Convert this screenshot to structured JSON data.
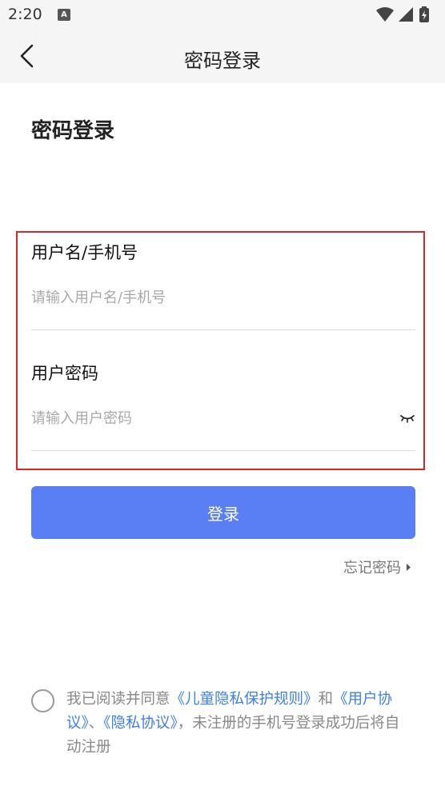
{
  "status_bar": {
    "time": "2:20",
    "notification_glyph": "A"
  },
  "nav": {
    "title": "密码登录"
  },
  "heading": "密码登录",
  "username_field": {
    "label": "用户名/手机号",
    "placeholder": "请输入用户名/手机号",
    "value": ""
  },
  "password_field": {
    "label": "用户密码",
    "placeholder": "请输入用户密码",
    "value": ""
  },
  "login_button": "登录",
  "forgot_password": "忘记密码",
  "agreement": {
    "prefix": "我已阅读并同意",
    "link_child_privacy": "《儿童隐私保护规则》",
    "and": "和",
    "link_user_agreement": "《用户协议》",
    "separator": "、",
    "link_privacy": "《隐私协议》",
    "suffix": "，未注册的手机号登录成功后将自动注册"
  },
  "colors": {
    "accent_button": "#5a7ff5",
    "link": "#3d7fe6",
    "highlight_border": "#d8262b"
  },
  "icons": [
    "back-arrow-icon",
    "wifi-icon",
    "signal-icon",
    "battery-icon",
    "eye-closed-icon",
    "caret-right-icon"
  ]
}
